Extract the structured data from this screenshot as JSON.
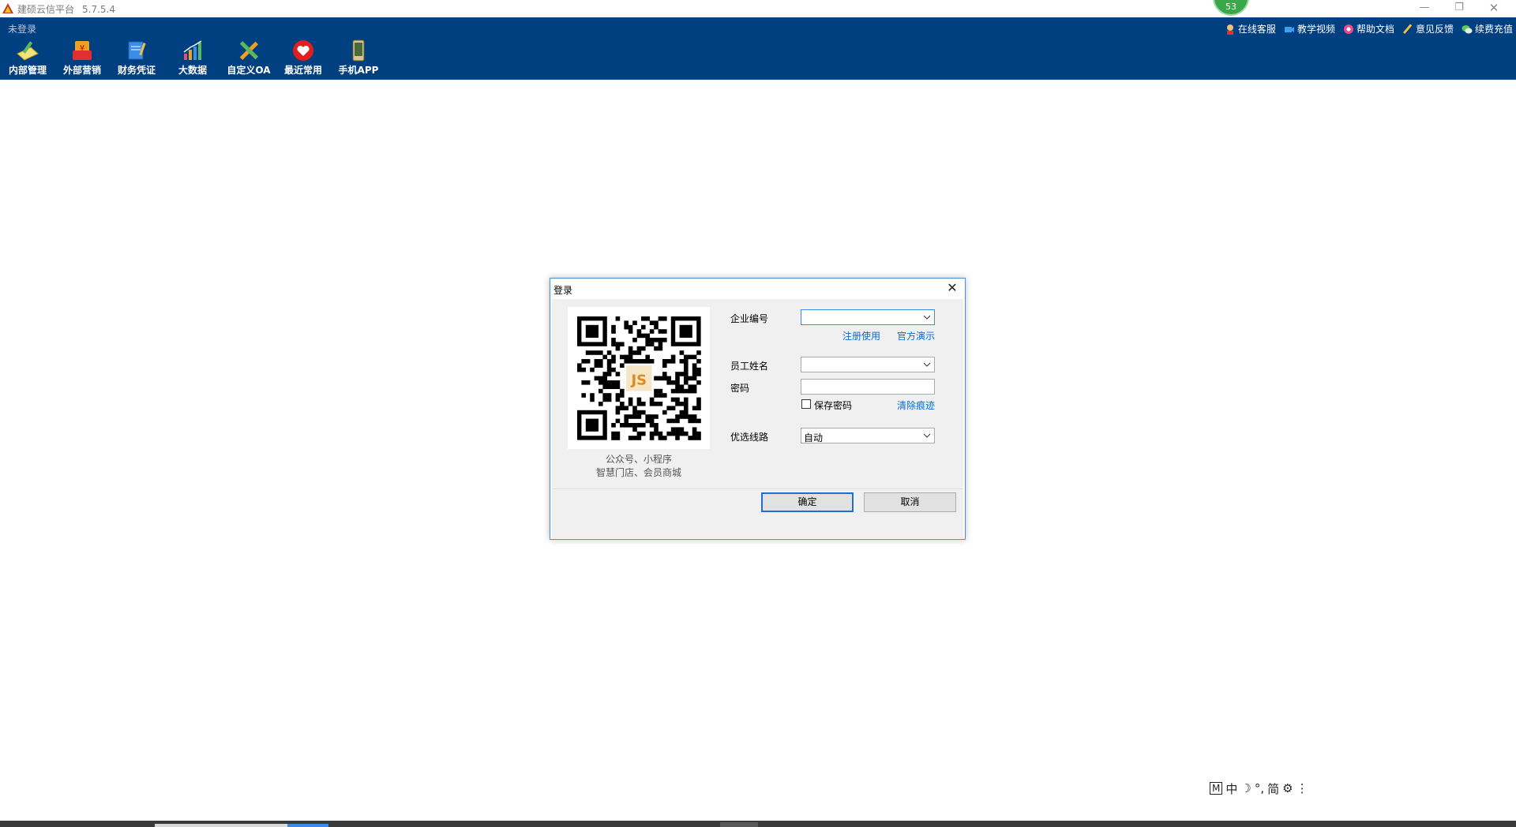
{
  "window": {
    "title": "建硕云信平台",
    "version": "5.7.5.4",
    "badge": "53"
  },
  "header": {
    "login_status": "未登录",
    "toolbar": [
      {
        "label": "内部管理",
        "icon": "notebook-pencil-icon"
      },
      {
        "label": "外部营销",
        "icon": "red-envelope-icon"
      },
      {
        "label": "财务凭证",
        "icon": "voucher-icon"
      },
      {
        "label": "大数据",
        "icon": "bar-chart-icon"
      },
      {
        "label": "自定义OA",
        "icon": "pencil-ruler-icon"
      },
      {
        "label": "最近常用",
        "icon": "heart-icon"
      },
      {
        "label": "手机APP",
        "icon": "phone-icon"
      }
    ],
    "links": [
      {
        "label": "在线客服",
        "icon": "customer-service-icon"
      },
      {
        "label": "教学视频",
        "icon": "video-camera-icon"
      },
      {
        "label": "帮助文档",
        "icon": "help-icon"
      },
      {
        "label": "意见反馈",
        "icon": "feedback-pen-icon"
      },
      {
        "label": "续费充值",
        "icon": "wechat-icon"
      }
    ]
  },
  "dialog": {
    "title": "登录",
    "qr_caption_line1": "公众号、小程序",
    "qr_caption_line2": "智慧门店、会员商城",
    "company_label": "企业编号",
    "company_value": "",
    "register_link": "注册使用",
    "demo_link": "官方演示",
    "employee_label": "员工姓名",
    "employee_value": "",
    "password_label": "密码",
    "save_password": "保存密码",
    "save_password_checked": false,
    "clear_link": "清除痕迹",
    "route_label": "优选线路",
    "route_value": "自动",
    "ok_button": "确定",
    "cancel_button": "取消"
  },
  "ime": {
    "mode": "M",
    "lang": "中",
    "simplified": "简"
  }
}
